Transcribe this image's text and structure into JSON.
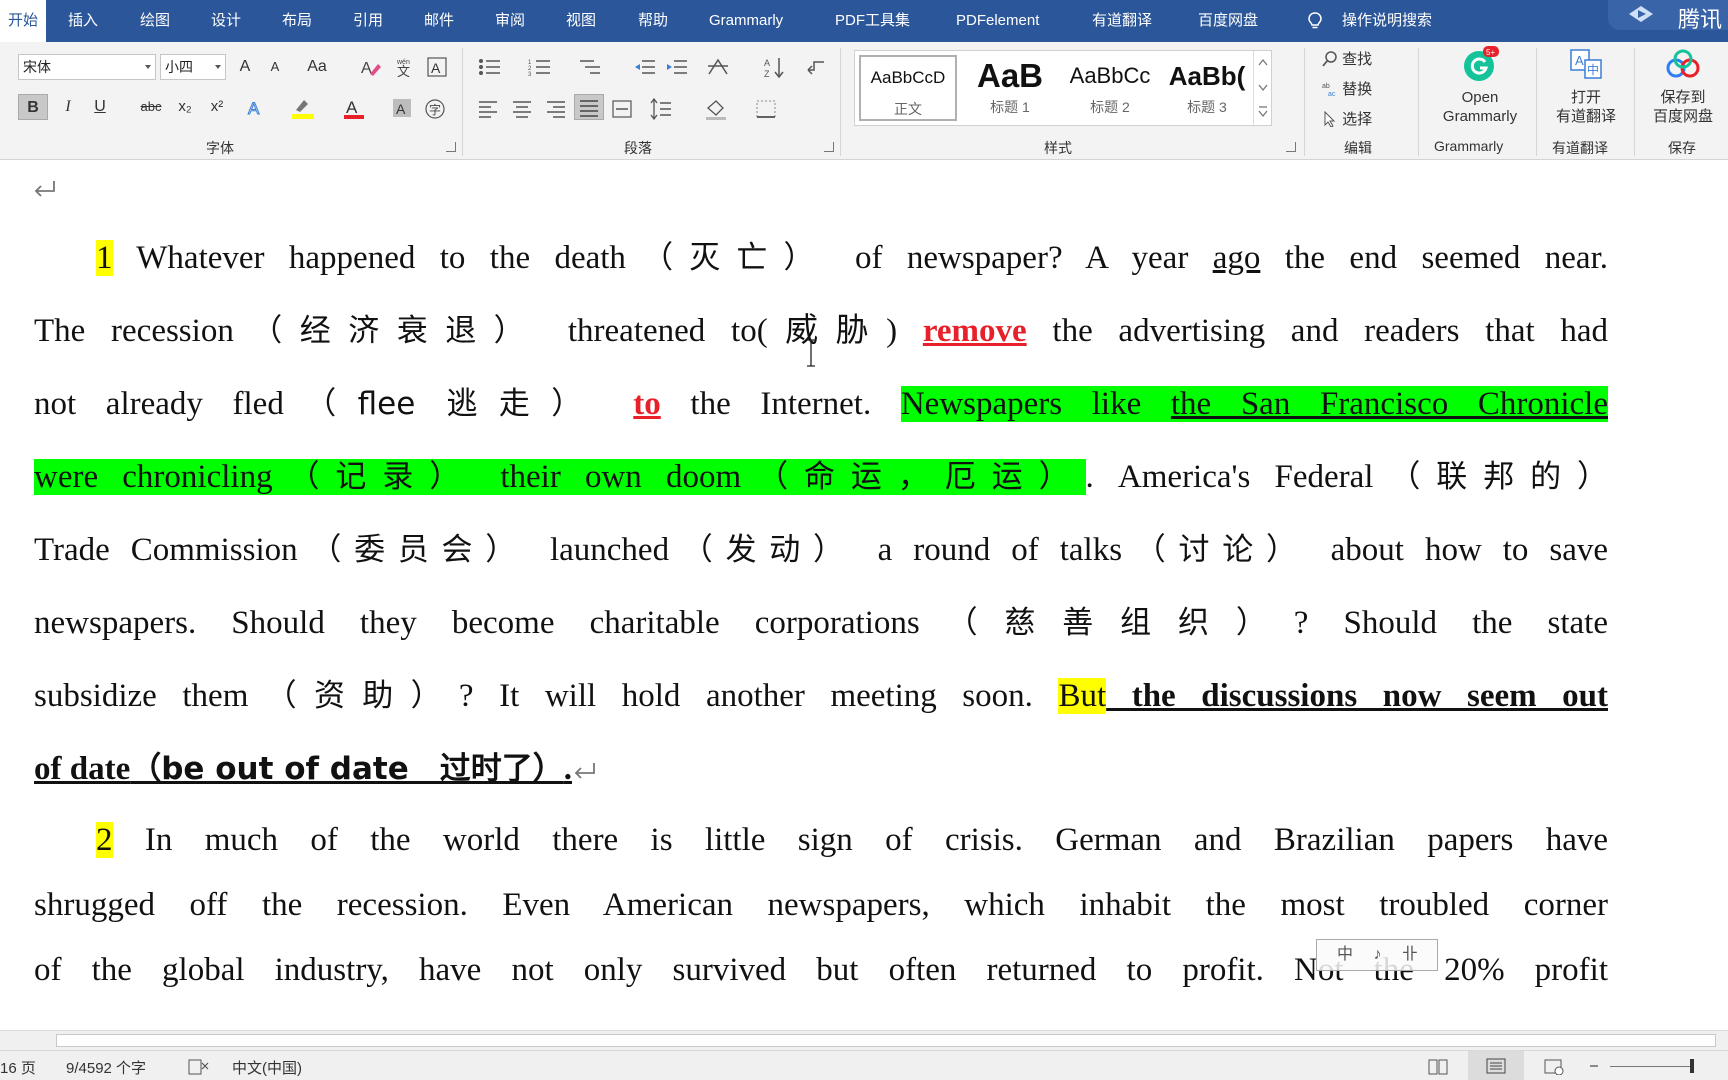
{
  "menubar": {
    "tabs": [
      "开始",
      "插入",
      "绘图",
      "设计",
      "布局",
      "引用",
      "邮件",
      "审阅",
      "视图",
      "帮助",
      "Grammarly",
      "PDF工具集",
      "PDFelement",
      "有道翻译",
      "百度网盘"
    ],
    "search_label": "操作说明搜索",
    "brand_text": "腾讯",
    "accent": "#2b579a"
  },
  "ribbon": {
    "font": {
      "name": "宋体",
      "size": "小四",
      "grow": "A",
      "shrink": "A",
      "case": "Aa",
      "bold": "B",
      "italic": "I",
      "underline": "U",
      "strike": "abc",
      "sub": "x₂",
      "sup": "x²",
      "group_label": "字体"
    },
    "paragraph": {
      "group_label": "段落"
    },
    "styles": {
      "items": [
        {
          "preview": "AaBbCcD",
          "name": "正文"
        },
        {
          "preview": "AaB",
          "name": "标题 1"
        },
        {
          "preview": "AaBbCc",
          "name": "标题 2"
        },
        {
          "preview": "AaBb(",
          "name": "标题 3"
        }
      ],
      "group_label": "样式"
    },
    "editing": {
      "find": "查找",
      "replace": "替换",
      "select": "选择",
      "group_label": "编辑"
    },
    "grammarly": {
      "line1": "Open",
      "line2": "Grammarly",
      "group_label": "Grammarly",
      "badge": "5+"
    },
    "youdao": {
      "line1": "打开",
      "line2": "有道翻译",
      "group_label": "有道翻译"
    },
    "baidu": {
      "line1": "保存到",
      "line2": "百度网盘",
      "group_label": "保存"
    }
  },
  "doc": {
    "p1": {
      "num": "1",
      "l1": {
        "a": " Whatever happened to the death",
        "b": "（灭亡）",
        "c": " of newspaper? A year ",
        "ago": "ago",
        "d": " the end seemed near."
      },
      "l2": {
        "a": "The recession",
        "b": "（经济衰退）",
        "c": " threatened to(威胁) ",
        "remove": "remove",
        "d": " the advertising and readers that had"
      },
      "l3": {
        "a": "not already fled",
        "b": "（flee 逃走）",
        "to": "to",
        "c": " the Internet. ",
        "g1": "Newspapers like ",
        "g2": "the San Francisco Chronicle"
      },
      "l4": {
        "g1": "were chronicling",
        "g2": "（记录）",
        "g3": " their own doom",
        "g4": "（命运，厄运）",
        "a": ". America's Federal",
        "b": "（联邦的）"
      },
      "l5": {
        "a": "Trade Commission",
        "b": "（委员会）",
        "c": " launched",
        "d": "（发动）",
        "e": " a round of talks",
        "f": "（讨论）",
        "g": " about how to save"
      },
      "l6": {
        "a": "newspapers. Should they become charitable corporations",
        "b": "（慈善组织）",
        "c": "? Should the state"
      },
      "l7": {
        "a": "subsidize them",
        "b": "（资助）",
        "c": "? It will hold another meeting soon. ",
        "but": "But",
        "d": " the discussions now seem out"
      },
      "l8": {
        "a": "of date",
        "b": "（be out of date　过时了）",
        "c": "."
      }
    },
    "p2": {
      "num": "2",
      "l1": " In much of the world there is little sign of crisis. German and Brazilian papers have",
      "l2": "shrugged off the recession. Even American newspapers, which inhabit the most troubled corner",
      "l3": "of the global industry, have not only survived but often returned to profit. Not the 20% profit"
    },
    "ime_text": "中 ♪ 卝"
  },
  "status": {
    "page": "16 页",
    "words": "9/4592 个字",
    "lang": "中文(中国)"
  }
}
